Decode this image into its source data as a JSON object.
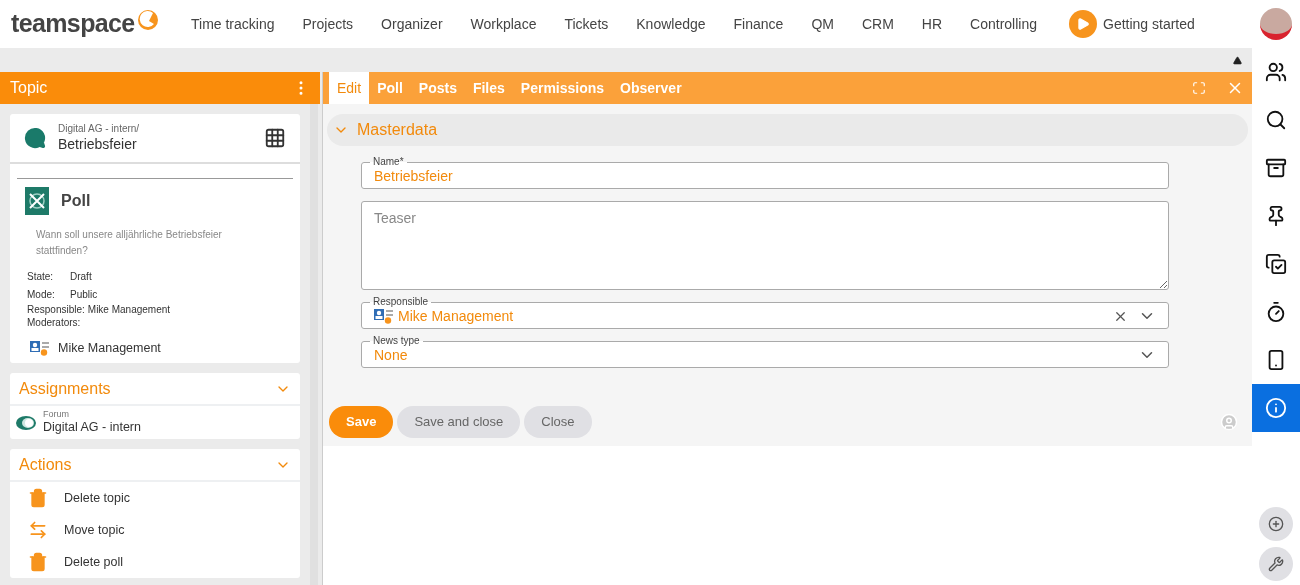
{
  "header": {
    "logo": "teamspace",
    "nav": [
      "Time tracking",
      "Projects",
      "Organizer",
      "Workplace",
      "Tickets",
      "Knowledge",
      "Finance",
      "QM",
      "CRM",
      "HR",
      "Controlling"
    ],
    "getting_started": "Getting started"
  },
  "topic_panel": {
    "title": "Topic",
    "card": {
      "path": "Digital AG - intern/",
      "name": "Betriebsfeier"
    },
    "poll": {
      "title": "Poll",
      "question": "Wann soll unsere alljährliche Betriebsfeier stattfinden?",
      "details": [
        {
          "label": "State:",
          "value": "Draft"
        },
        {
          "label": "Mode:",
          "value": "Public"
        },
        {
          "label": "Responsible:",
          "value": "Mike Management"
        },
        {
          "label": "Moderators:"
        }
      ],
      "moderators": [
        "Mike Management"
      ]
    },
    "assignments": {
      "title": "Assignments",
      "expanded": true,
      "items": [
        {
          "type": "Forum",
          "name": "Digital AG - intern"
        }
      ]
    },
    "actions": {
      "title": "Actions",
      "expanded": true,
      "items": [
        {
          "kind": "delete",
          "label": "Delete topic"
        },
        {
          "kind": "move",
          "label": "Move topic"
        },
        {
          "kind": "delete",
          "label": "Delete poll"
        }
      ]
    }
  },
  "tabs": [
    {
      "label": "Edit",
      "selected": true
    },
    {
      "label": "Poll",
      "selected": false
    },
    {
      "label": "Posts",
      "selected": false
    },
    {
      "label": "Files",
      "selected": false
    },
    {
      "label": "Permissions",
      "selected": false
    },
    {
      "label": "Observer",
      "selected": false
    }
  ],
  "section": {
    "title": "Masterdata",
    "expanded": true,
    "fields": [
      {
        "kind": "text",
        "label": "Name*",
        "value": "Betriebsfeier"
      },
      {
        "kind": "textarea",
        "placeholder": "Teaser"
      },
      {
        "kind": "person",
        "label": "Responsible",
        "value": "Mike Management"
      },
      {
        "kind": "select",
        "label": "News type",
        "value": "None"
      }
    ]
  },
  "buttons": [
    {
      "label": "Save",
      "primary": true
    },
    {
      "label": "Save and close",
      "primary": false
    },
    {
      "label": "Close",
      "primary": false
    }
  ],
  "side_tools": [
    {
      "kind": "people",
      "selected": false
    },
    {
      "kind": "search",
      "selected": false
    },
    {
      "kind": "inbox",
      "selected": false
    },
    {
      "kind": "pin",
      "selected": false
    },
    {
      "kind": "tasks",
      "selected": false
    },
    {
      "kind": "timer",
      "selected": false
    },
    {
      "kind": "phone",
      "selected": false
    },
    {
      "kind": "info",
      "selected": true
    }
  ]
}
